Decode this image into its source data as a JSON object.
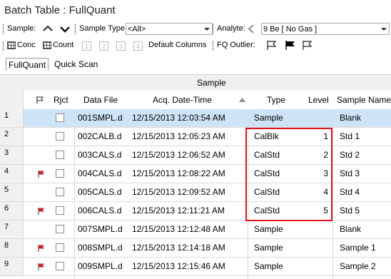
{
  "window": {
    "title": "Batch Table : FullQuant"
  },
  "toolbar1": {
    "sample_label": "Sample:",
    "sample_type_label": "Sample Type:",
    "sample_type_value": "<All>",
    "analyte_label": "Analyte:",
    "analyte_value": "9  Be  [ No Gas ]"
  },
  "toolbar2": {
    "conc_label": "Conc",
    "count_label": "Count",
    "layout_nums": [
      "1",
      "2",
      "3",
      "4"
    ],
    "default_columns_label": "Default Columns",
    "fq_outlier_label": "FQ Outlier:"
  },
  "tabs": [
    {
      "label": "FullQuant",
      "active": true
    },
    {
      "label": "Quick Scan",
      "active": false
    }
  ],
  "grid": {
    "group_header": "Sample",
    "columns": {
      "rjct": "Rjct",
      "data_file": "Data File",
      "acq_datetime": "Acq. Date-Time",
      "type": "Type",
      "level": "Level",
      "sample_name": "Sample Name"
    },
    "rows": [
      {
        "num": "1",
        "flag": false,
        "file": "001SMPL.d",
        "time": "12/15/2013 12:03:54 AM",
        "type": "Sample",
        "level": "",
        "name": "Blank",
        "selected": true
      },
      {
        "num": "2",
        "flag": false,
        "file": "002CALB.d",
        "time": "12/15/2013 12:05:23 AM",
        "type": "CalBlk",
        "level": "1",
        "name": "Std 1",
        "selected": false
      },
      {
        "num": "3",
        "flag": false,
        "file": "003CALS.d",
        "time": "12/15/2013 12:06:52 AM",
        "type": "CalStd",
        "level": "2",
        "name": "Std 2",
        "selected": false
      },
      {
        "num": "4",
        "flag": true,
        "file": "004CALS.d",
        "time": "12/15/2013 12:08:22 AM",
        "type": "CalStd",
        "level": "3",
        "name": "Std 3",
        "selected": false
      },
      {
        "num": "5",
        "flag": false,
        "file": "005CALS.d",
        "time": "12/15/2013 12:09:52 AM",
        "type": "CalStd",
        "level": "4",
        "name": "Std 4",
        "selected": false
      },
      {
        "num": "6",
        "flag": true,
        "file": "006CALS.d",
        "time": "12/15/2013 12:11:21 AM",
        "type": "CalStd",
        "level": "5",
        "name": "Std 5",
        "selected": false
      },
      {
        "num": "7",
        "flag": false,
        "file": "007SMPL.d",
        "time": "12/15/2013 12:12:48 AM",
        "type": "Sample",
        "level": "",
        "name": "Blank",
        "selected": false
      },
      {
        "num": "8",
        "flag": true,
        "file": "008SMPL.d",
        "time": "12/15/2013 12:14:18 AM",
        "type": "Sample",
        "level": "",
        "name": "Sample 1",
        "selected": false
      },
      {
        "num": "9",
        "flag": true,
        "file": "009SMPL.d",
        "time": "12/15/2013 12:15:46 AM",
        "type": "Sample",
        "level": "",
        "name": "Sample 2",
        "selected": false
      }
    ]
  },
  "colors": {
    "selection": "#cfe3f7",
    "highlight_box": "#e0141c",
    "flag": "#c0282d"
  }
}
